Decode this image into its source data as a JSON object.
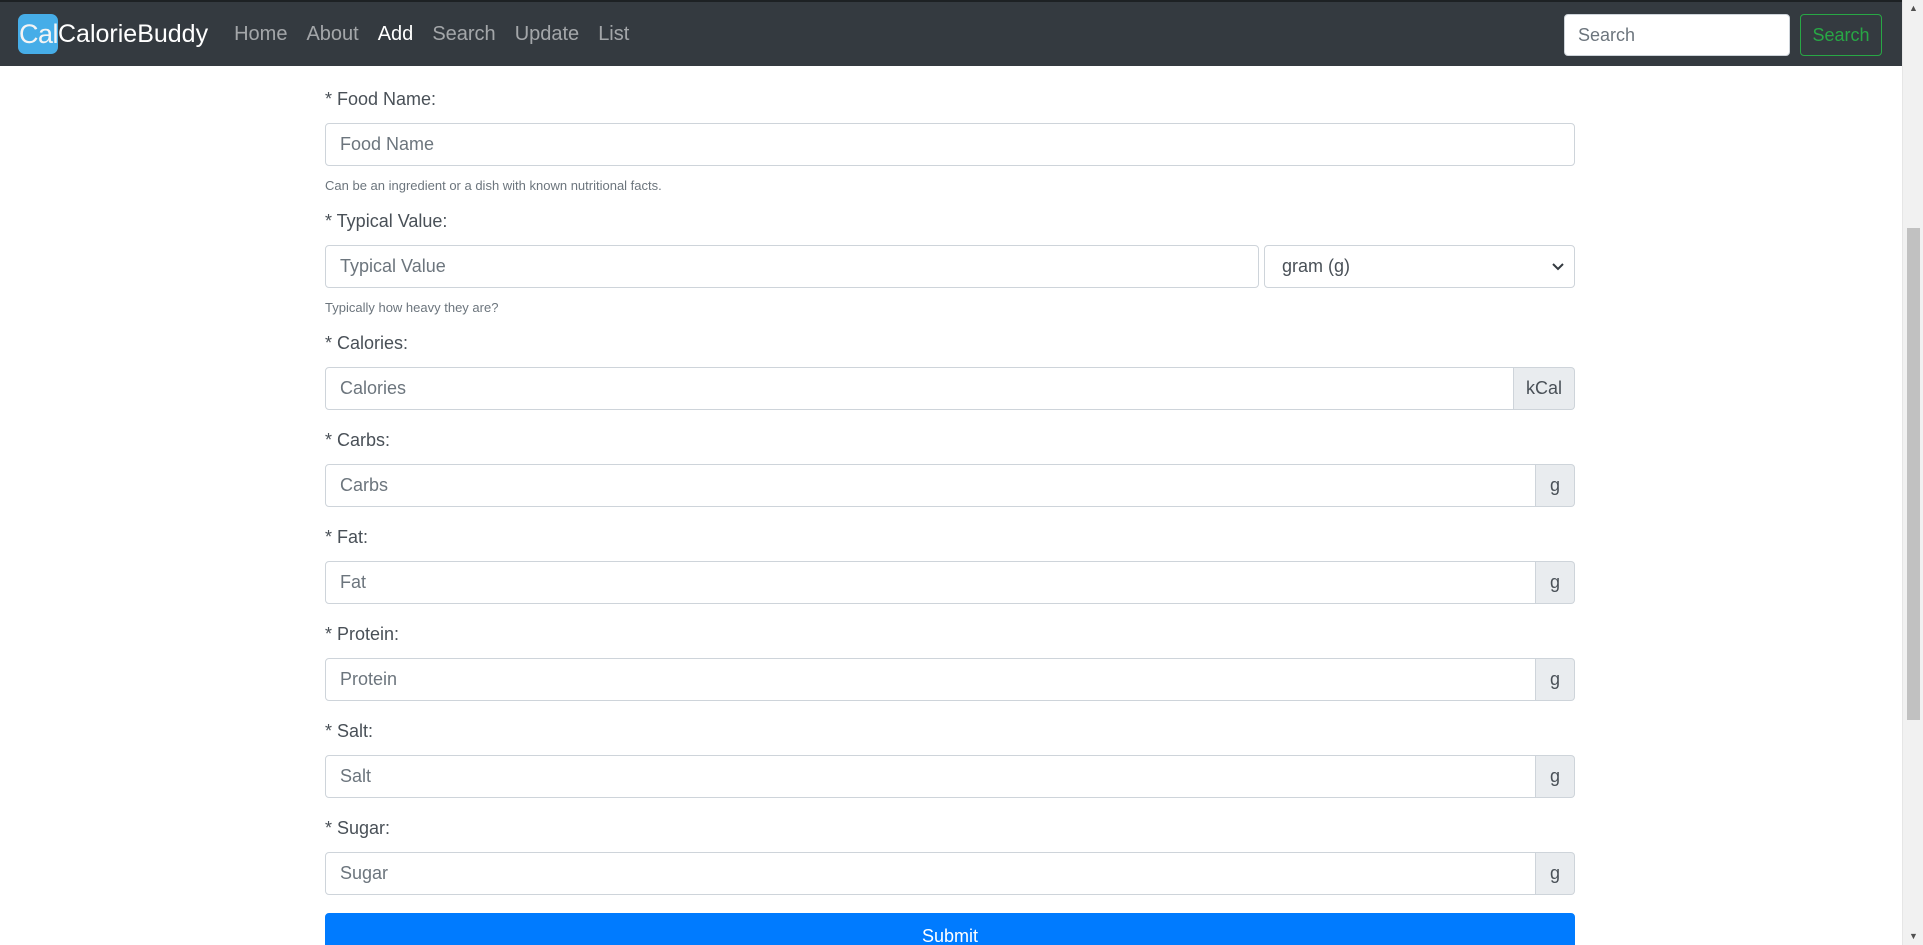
{
  "navbar": {
    "brand_logo": "Cal",
    "brand_name": "CalorieBuddy",
    "links": [
      {
        "label": "Home",
        "active": false
      },
      {
        "label": "About",
        "active": false
      },
      {
        "label": "Add",
        "active": true
      },
      {
        "label": "Search",
        "active": false
      },
      {
        "label": "Update",
        "active": false
      },
      {
        "label": "List",
        "active": false
      }
    ],
    "search_placeholder": "Search",
    "search_button": "Search"
  },
  "form": {
    "food_name": {
      "label": "* Food Name:",
      "placeholder": "Food Name",
      "help": "Can be an ingredient or a dish with known nutritional facts."
    },
    "typical_value": {
      "label": "* Typical Value:",
      "placeholder": "Typical Value",
      "unit_selected": "gram (g)",
      "help": "Typically how heavy they are?"
    },
    "calories": {
      "label": "* Calories:",
      "placeholder": "Calories",
      "unit": "kCal"
    },
    "carbs": {
      "label": "* Carbs:",
      "placeholder": "Carbs",
      "unit": "g"
    },
    "fat": {
      "label": "* Fat:",
      "placeholder": "Fat",
      "unit": "g"
    },
    "protein": {
      "label": "* Protein:",
      "placeholder": "Protein",
      "unit": "g"
    },
    "salt": {
      "label": "* Salt:",
      "placeholder": "Salt",
      "unit": "g"
    },
    "sugar": {
      "label": "* Sugar:",
      "placeholder": "Sugar",
      "unit": "g"
    },
    "submit_label": "Submit"
  },
  "colors": {
    "navbar_bg": "#343a40",
    "brand_logo_bg": "#47b4f1",
    "search_button": "#28a745",
    "submit_button": "#007bff"
  }
}
